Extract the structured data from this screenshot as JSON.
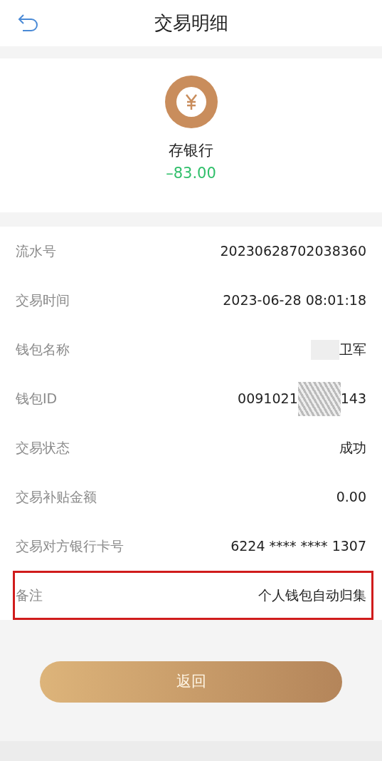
{
  "header": {
    "title": "交易明细"
  },
  "summary": {
    "name": "存银行",
    "amount": "–83.00"
  },
  "rows": [
    {
      "label": "流水号",
      "value_parts": [
        "20230628702038360"
      ],
      "redacted": false,
      "highlighted": false
    },
    {
      "label": "交易时间",
      "value_parts": [
        "2023-06-28 08:01:18"
      ],
      "redacted": false,
      "highlighted": false
    },
    {
      "label": "钱包名称",
      "value_parts": [
        "卫军"
      ],
      "redacted": true,
      "highlighted": false
    },
    {
      "label": "钱包ID",
      "value_parts": [
        "0091021",
        "143"
      ],
      "redacted": true,
      "highlighted": false
    },
    {
      "label": "交易状态",
      "value_parts": [
        "成功"
      ],
      "redacted": false,
      "highlighted": false
    },
    {
      "label": "交易补贴金额",
      "value_parts": [
        "0.00"
      ],
      "redacted": false,
      "highlighted": false
    },
    {
      "label": "交易对方银行卡号",
      "value_parts": [
        "6224 **** **** 1307"
      ],
      "redacted": false,
      "highlighted": false
    },
    {
      "label": "备注",
      "value_parts": [
        "个人钱包自动归集"
      ],
      "redacted": false,
      "highlighted": true
    }
  ],
  "button": {
    "label": "返回"
  }
}
